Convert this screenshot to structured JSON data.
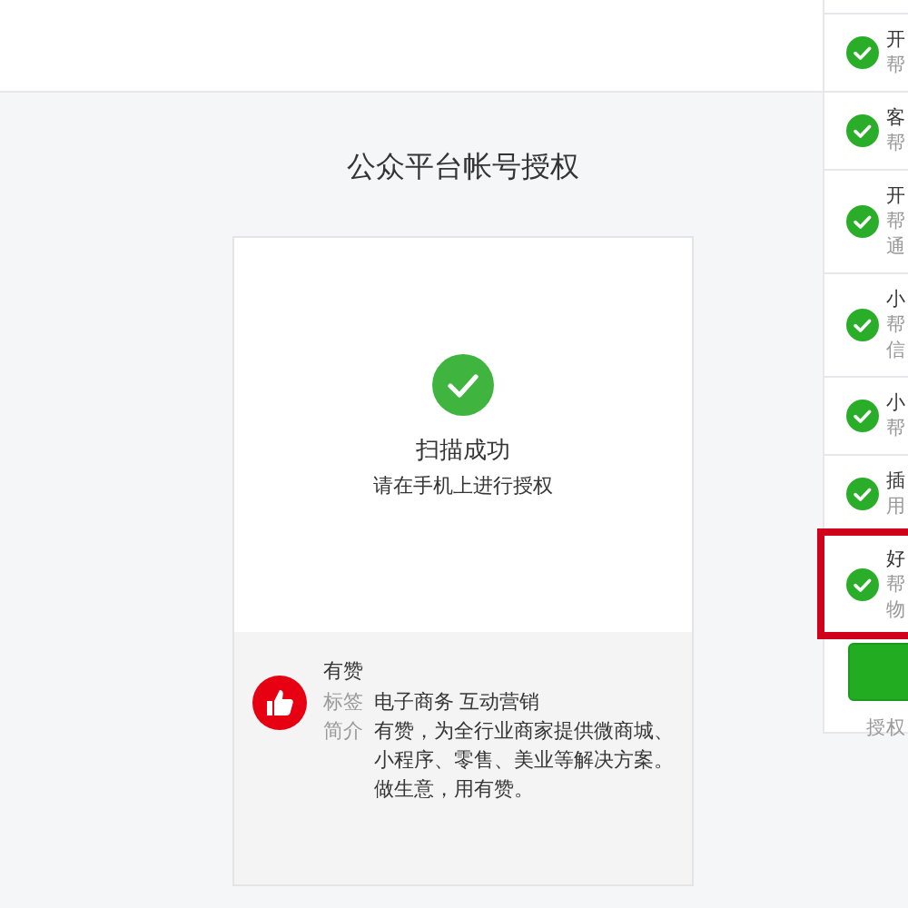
{
  "page_title": "公众平台帐号授权",
  "scan": {
    "checked": true,
    "title": "扫描成功",
    "subtitle": "请在手机上进行授权"
  },
  "account": {
    "name": "有赞",
    "fields": [
      {
        "label": "标签",
        "value": "电子商务 互动营销"
      },
      {
        "label": "简介",
        "value": "有赞，为全行业商家提供微商城、小程序、零售、美业等解决方案。做生意，用有赞。"
      }
    ]
  },
  "permissions": [
    {
      "title": "开",
      "lines": [
        "帮"
      ],
      "checked": true,
      "selected": false
    },
    {
      "title": "客",
      "lines": [
        "帮"
      ],
      "checked": true,
      "selected": false
    },
    {
      "title": "开",
      "lines": [
        "帮",
        "通"
      ],
      "checked": true,
      "selected": false
    },
    {
      "title": "小",
      "lines": [
        "帮",
        "信"
      ],
      "checked": true,
      "selected": false
    },
    {
      "title": "小",
      "lines": [
        "帮"
      ],
      "checked": true,
      "selected": false
    },
    {
      "title": "插",
      "lines": [
        "用"
      ],
      "checked": true,
      "selected": false
    },
    {
      "title": "好",
      "lines": [
        "帮",
        "物"
      ],
      "checked": true,
      "selected": true
    }
  ],
  "footer_note": "授权"
}
